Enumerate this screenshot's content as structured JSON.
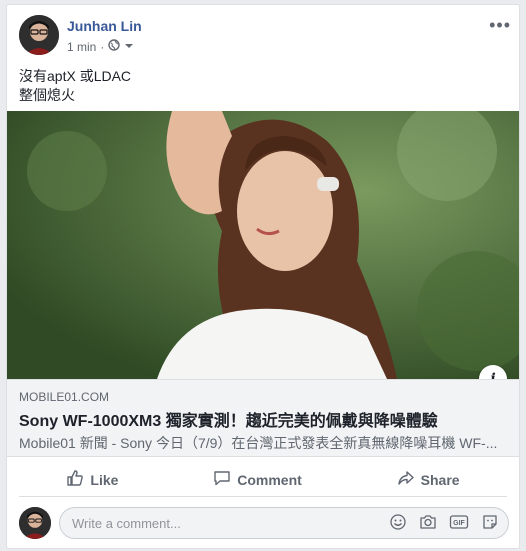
{
  "post": {
    "author": "Junhan Lin",
    "time": "1 min",
    "dot": "·",
    "text_lines": [
      "沒有aptX 或LDAC",
      "整個熄火"
    ],
    "menu": "•••"
  },
  "link": {
    "domain": "MOBILE01.COM",
    "title": "Sony WF-1000XM3 獨家實測！趨近完美的佩戴與降噪體驗",
    "description": "Mobile01 新聞 - Sony 今日（7/9）在台灣正式發表全新真無線降噪耳機 WF-...",
    "info": "i"
  },
  "actions": {
    "like": "Like",
    "comment": "Comment",
    "share": "Share"
  },
  "comment_box": {
    "placeholder": "Write a comment..."
  },
  "icons": {
    "privacy": "globe-icon",
    "dropdown": "chevron-down-icon",
    "like": "thumbs-up-icon",
    "comment": "comment-bubble-icon",
    "share": "share-arrow-icon",
    "emoji": "emoji-icon",
    "camera": "camera-icon",
    "gif": "gif-icon",
    "sticker": "sticker-icon"
  },
  "colors": {
    "author": "#385898",
    "muted": "#606770",
    "link_bg": "#f2f3f5"
  }
}
